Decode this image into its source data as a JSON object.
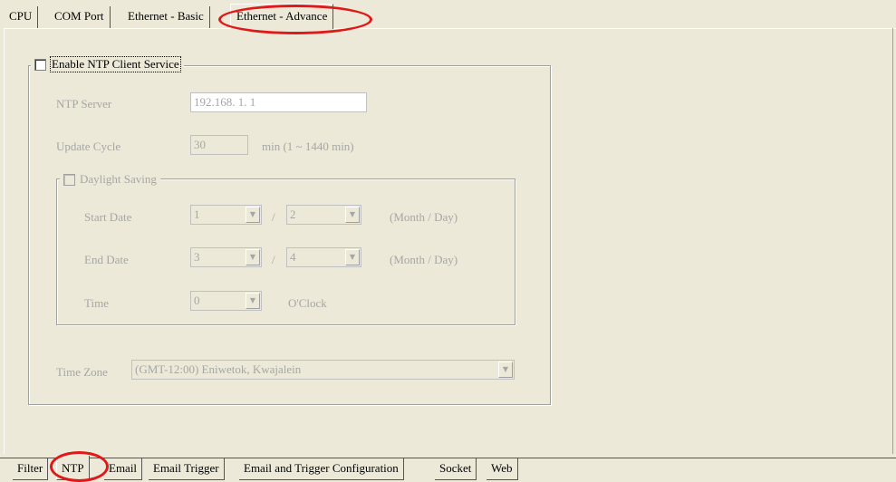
{
  "top_tabs": [
    "CPU",
    "COM Port",
    "Ethernet - Basic",
    "Ethernet - Advance"
  ],
  "ntp": {
    "enable_label": "Enable NTP Client Service",
    "server_label": "NTP Server",
    "server_value": "192.168.  1.  1",
    "update_cycle_label": "Update Cycle",
    "update_cycle_value": "30",
    "update_cycle_unit": "min (1 ~ 1440 min)",
    "daylight_label": "Daylight Saving",
    "start_date_label": "Start Date",
    "start_month": "1",
    "start_day": "2",
    "end_date_label": "End Date",
    "end_month": "3",
    "end_day": "4",
    "slash": "/",
    "month_day_hint": "(Month / Day)",
    "time_label": "Time",
    "time_value": "0",
    "oclock": "O'Clock",
    "timezone_label": "Time Zone",
    "timezone_value": "(GMT-12:00) Eniwetok, Kwajalein"
  },
  "bottom_tabs": [
    "Filter",
    "NTP",
    "Email",
    "Email Trigger",
    "Email and Trigger Configuration",
    "Socket",
    "Web"
  ],
  "colors": {
    "highlight": "#e01818",
    "background": "#ECE9D8",
    "disabled_text": "#a6a6a6"
  },
  "icons": {
    "dropdown": "chevron-down-icon"
  }
}
